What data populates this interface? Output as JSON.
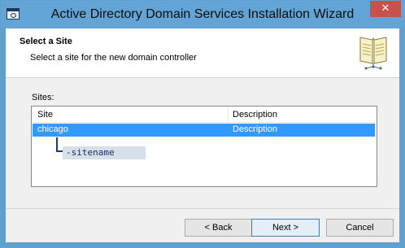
{
  "window": {
    "title": "Active Directory Domain Services Installation Wizard",
    "close_glyph": "✕"
  },
  "header": {
    "title": "Select a Site",
    "subtitle": "Select a site for the new domain controller",
    "icon": "book-icon"
  },
  "sites": {
    "label": "Sites:",
    "columns": [
      "Site",
      "Description"
    ],
    "rows": [
      {
        "site": "chicago",
        "description": "Description",
        "selected": true
      }
    ],
    "callout_text": "-sitename"
  },
  "footer": {
    "back_label": "< Back",
    "next_label": "Next >",
    "cancel_label": "Cancel"
  },
  "colors": {
    "title_bar": "#62a4d5",
    "selection": "#3399ff",
    "close_button": "#c7514d",
    "callout": "#1a3c7a"
  }
}
